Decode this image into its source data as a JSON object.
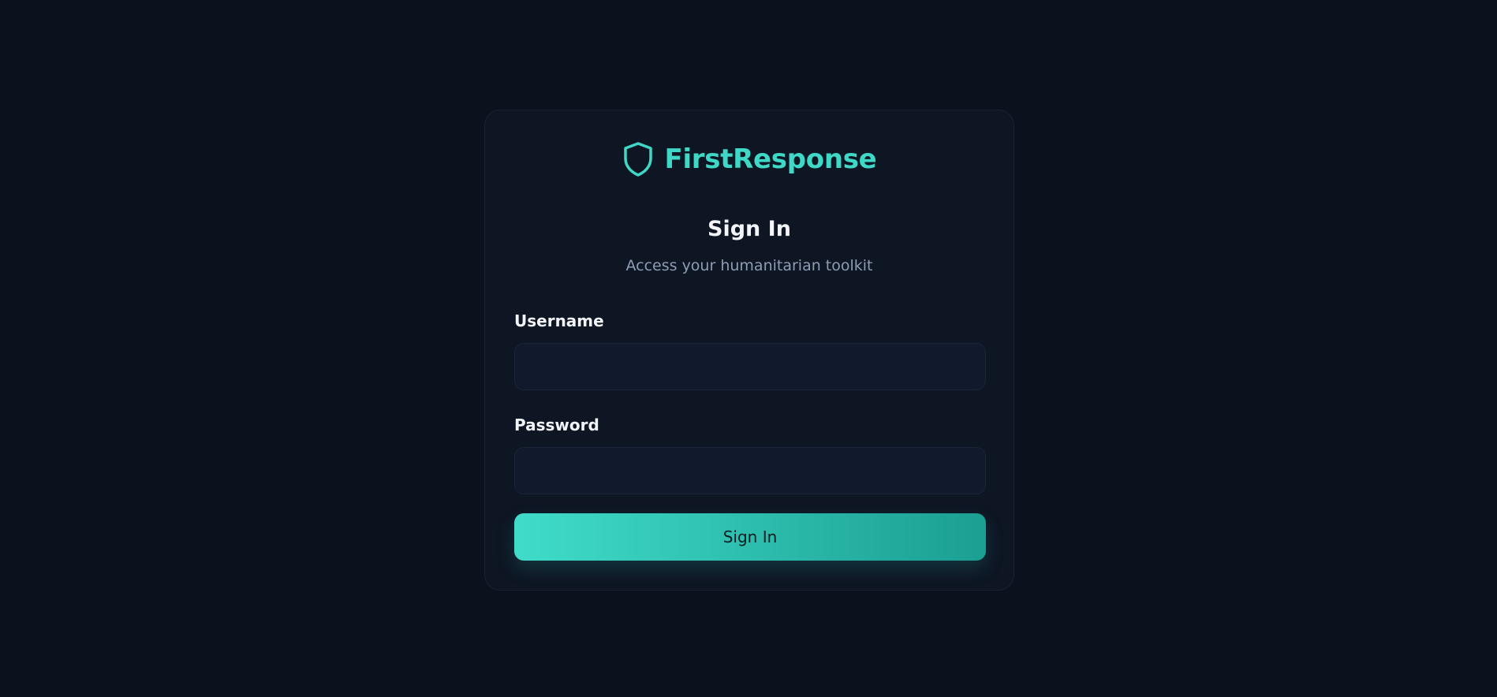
{
  "brand": {
    "name": "FirstResponse",
    "icon": "shield-icon",
    "accent_color": "#3fd8c7"
  },
  "login": {
    "title": "Sign In",
    "subtitle": "Access your humanitarian toolkit",
    "username_label": "Username",
    "username_value": "",
    "password_label": "Password",
    "password_value": "",
    "submit_label": "Sign In"
  }
}
